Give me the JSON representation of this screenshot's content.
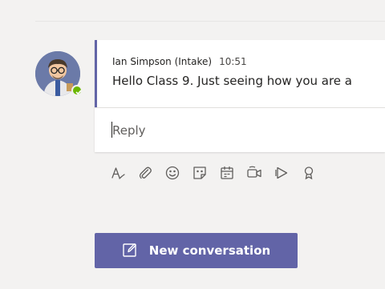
{
  "post": {
    "author": "Ian Simpson (Intake)",
    "time": "10:51",
    "message": "Hello Class 9.  Just seeing how you are a",
    "presence_color": "#6bb700",
    "avatar_icon": "user-avatar-icon"
  },
  "reply": {
    "placeholder": "Reply"
  },
  "toolbar": {
    "icons": [
      "format-icon",
      "attach-icon",
      "emoji-icon",
      "sticker-icon",
      "schedule-meeting-icon",
      "meet-now-icon",
      "stream-icon",
      "praise-icon"
    ]
  },
  "new_conversation": {
    "label": "New conversation",
    "color": "#6264a7"
  },
  "colors": {
    "accent": "#6264a7",
    "background": "#f3f2f1"
  }
}
